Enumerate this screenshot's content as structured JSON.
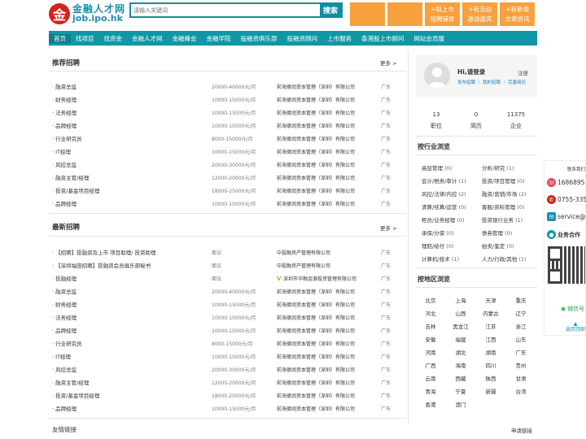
{
  "logo": {
    "mark": "金",
    "name_cn": "金融人才网",
    "domain": "job.ipo.hk"
  },
  "search": {
    "placeholder": "请输入关键词",
    "button": "搜索"
  },
  "promo": [
    {
      "line1": "",
      "line2": ""
    },
    {
      "line1": "",
      "line2": ""
    },
    {
      "line1": "+拟上市",
      "line2": "猎聘辅导"
    },
    {
      "line1": "+有活动",
      "line2": "邀请嘉宾"
    },
    {
      "line1": "+有新闻",
      "line2": "文章资讯"
    }
  ],
  "nav": [
    "首页",
    "找项目",
    "找资金",
    "金融人才网",
    "金融峰会",
    "金融学院",
    "投融资俱乐部",
    "投融资顾问",
    "上市服务",
    "香港股上市顾问",
    "网站会员服"
  ],
  "recommended": {
    "title": "推荐招聘",
    "more": "更多 >",
    "rows": [
      {
        "title": "· 融资总监",
        "salary": "20000-40000元/月",
        "company": "前海德润资本管理（深圳）有限公司",
        "location": "广东"
      },
      {
        "title": "· 财务经理",
        "salary": "10000-15000元/月",
        "company": "前海德润资本管理（深圳）有限公司",
        "location": "广东"
      },
      {
        "title": "· 法务经理",
        "salary": "10000-15000元/月",
        "company": "前海德润资本管理（深圳）有限公司",
        "location": "广东"
      },
      {
        "title": "· 品牌经理",
        "salary": "10000-15000元/月",
        "company": "前海德润资本管理（深圳）有限公司",
        "location": "广东"
      },
      {
        "title": "· 行业研究员",
        "salary": "8000-15000元/月",
        "company": "前海德润资本管理（深圳）有限公司",
        "location": "广东"
      },
      {
        "title": "· IT经理",
        "salary": "10000-15000元/月",
        "company": "前海德润资本管理（深圳）有限公司",
        "location": "广东"
      },
      {
        "title": "· 风控总监",
        "salary": "20000-30000元/月",
        "company": "前海德润资本管理（深圳）有限公司",
        "location": "广东"
      },
      {
        "title": "· 融资主管/经理",
        "salary": "12000-20000元/月",
        "company": "前海德润资本管理（深圳）有限公司",
        "location": "广东"
      },
      {
        "title": "· 投资/基金项目经理",
        "salary": "18000-25000元/月",
        "company": "前海德润资本管理（深圳）有限公司",
        "location": "广东"
      },
      {
        "title": "· 品牌经理",
        "salary": "10000-15000元/月",
        "company": "前海德润资本管理（深圳）有限公司",
        "location": "广东"
      }
    ]
  },
  "latest": {
    "title": "最新招聘",
    "more": "更多 >",
    "rows": [
      {
        "title": "· 【招聘】投融资及上市 项目助理/ 投资助理",
        "salary": "面议",
        "company": "中投融资产管理有限公司",
        "location": "广东",
        "v": false
      },
      {
        "title": "· 【深圳福田招聘】投融资会员俱乐部秘书",
        "salary": "面议",
        "company": "中投融资产管理有限公司",
        "location": "广东",
        "v": false
      },
      {
        "title": "· 投融经理",
        "salary": "面议",
        "company": "深圳市华融金源投资管理有限公司",
        "location": "广东",
        "v": true
      },
      {
        "title": "· 融资总监",
        "salary": "20000-40000元/月",
        "company": "前海德润资本管理（深圳）有限公司",
        "location": "广东",
        "v": false
      },
      {
        "title": "· 财务经理",
        "salary": "10000-15000元/月",
        "company": "前海德润资本管理（深圳）有限公司",
        "location": "广东",
        "v": false
      },
      {
        "title": "· 法务经理",
        "salary": "10000-15000元/月",
        "company": "前海德润资本管理（深圳）有限公司",
        "location": "广东",
        "v": false
      },
      {
        "title": "· 品牌经理",
        "salary": "10000-15000元/月",
        "company": "前海德润资本管理（深圳）有限公司",
        "location": "广东",
        "v": false
      },
      {
        "title": "· 行业研究员",
        "salary": "8000-15000元/月",
        "company": "前海德润资本管理（深圳）有限公司",
        "location": "广东",
        "v": false
      },
      {
        "title": "· IT经理",
        "salary": "10000-15000元/月",
        "company": "前海德润资本管理（深圳）有限公司",
        "location": "广东",
        "v": false
      },
      {
        "title": "· 风控总监",
        "salary": "20000-30000元/月",
        "company": "前海德润资本管理（深圳）有限公司",
        "location": "广东",
        "v": false
      },
      {
        "title": "· 融资主管/经理",
        "salary": "12000-20000元/月",
        "company": "前海德润资本管理（深圳）有限公司",
        "location": "广东",
        "v": false
      },
      {
        "title": "· 投资/基金项目经理",
        "salary": "18000-25000元/月",
        "company": "前海德润资本管理（深圳）有限公司",
        "location": "广东",
        "v": false
      },
      {
        "title": "· 品牌经理",
        "salary": "10000-15000元/月",
        "company": "前海德润资本管理（深圳）有限公司",
        "location": "广东",
        "v": false
      }
    ]
  },
  "login": {
    "greeting": "Hi,请登录",
    "register": "注册",
    "links": "发布招聘 ｜ 我的招聘 ｜ 完善简历"
  },
  "stats": [
    {
      "value": "13",
      "label": "职位"
    },
    {
      "value": "0",
      "label": "简历"
    },
    {
      "value": "11375",
      "label": "企业"
    }
  ],
  "industry": {
    "title": "按行业浏览",
    "items": [
      {
        "label": "高层管理",
        "count": "(0)"
      },
      {
        "label": "分析/研究",
        "count": "(1)"
      },
      {
        "label": "会计/税务/审计",
        "count": "(1)"
      },
      {
        "label": "投资/项目管理",
        "count": "(0)"
      },
      {
        "label": "风控/法律/内控",
        "count": "(2)"
      },
      {
        "label": "融资/营销/市场",
        "count": "(2)"
      },
      {
        "label": "清算/结算/运营",
        "count": "(0)"
      },
      {
        "label": "客服/资料管理",
        "count": "(0)"
      },
      {
        "label": "柜员/业务经理",
        "count": "(0)"
      },
      {
        "label": "投资银行业务",
        "count": "(1)"
      },
      {
        "label": "承保/分保",
        "count": "(0)"
      },
      {
        "label": "债券管理",
        "count": "(0)"
      },
      {
        "label": "理赔/给付",
        "count": "(0)"
      },
      {
        "label": "拍卖/鉴定",
        "count": "(0)"
      },
      {
        "label": "计算机/技术",
        "count": "(1)"
      },
      {
        "label": "人力/行政/其他",
        "count": "(1)"
      }
    ]
  },
  "region": {
    "title": "按地区浏览",
    "items": [
      "北京",
      "上海",
      "天津",
      "重庆",
      "河北",
      "山西",
      "内蒙古",
      "辽宁",
      "吉林",
      "黑龙江",
      "江苏",
      "浙江",
      "安徽",
      "福建",
      "江西",
      "山东",
      "河南",
      "湖北",
      "湖南",
      "广东",
      "广西",
      "海南",
      "四川",
      "贵州",
      "云南",
      "西藏",
      "陕西",
      "甘肃",
      "青海",
      "宁夏",
      "新疆",
      "台湾",
      "香港",
      "澳门"
    ]
  },
  "contact": {
    "header": "联系我们",
    "phone1": "1686895",
    "phone2": "0755-335",
    "email": "service@",
    "biz": "业务合作",
    "wechat": "微信号",
    "back_top": "返回顶部"
  },
  "footer": {
    "left": "友情链接",
    "right": "申请链接"
  },
  "colors": {
    "teal": "#0f97a5",
    "orange": "#f7a03c",
    "red": "#d2221b"
  }
}
